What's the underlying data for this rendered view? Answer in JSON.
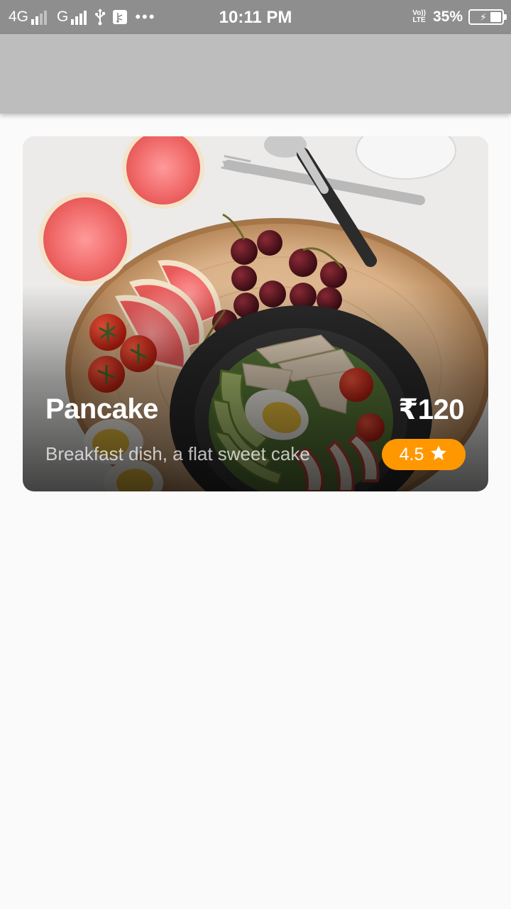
{
  "status_bar": {
    "network_1": "4G",
    "network_2": "G",
    "time": "10:11 PM",
    "volte_top": "Vo))",
    "volte_bottom": "LTE",
    "battery_percent": "35%",
    "battery_level": 0.35,
    "charging": true
  },
  "app_bar": {},
  "card": {
    "title": "Pancake",
    "price": "₹120",
    "description": "Breakfast dish, a flat sweet cake",
    "rating": "4.5",
    "rating_icon": "star-icon",
    "image": "food-photo"
  },
  "colors": {
    "status_bar": "#8e8e8e",
    "app_bar": "#bdbdbd",
    "background": "#fafafa",
    "rating_badge": "#ff9800"
  }
}
